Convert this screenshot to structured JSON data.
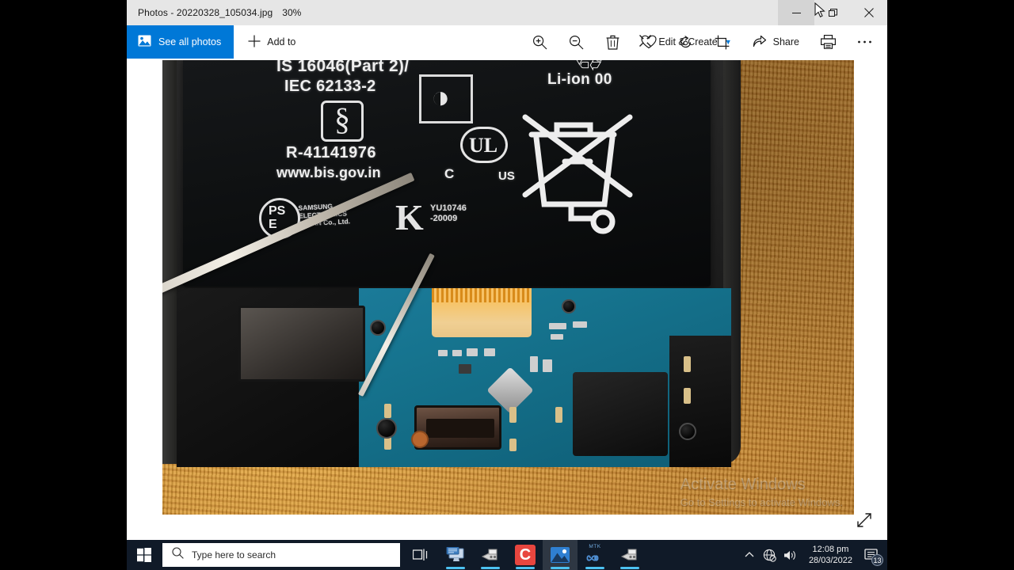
{
  "window": {
    "title": "Photos - 20220328_105034.jpg",
    "zoom_level": "30%",
    "controls": {
      "minimize": "minimize-button",
      "restore": "restore-button",
      "close": "close-button"
    }
  },
  "toolbar": {
    "see_all_photos": "See all photos",
    "add_to": "Add to",
    "zoom_in": "Zoom in",
    "zoom_out": "Zoom out",
    "delete": "Delete",
    "favorite": "Add to favorites",
    "rotate": "Rotate",
    "crop": "Crop & rotate",
    "edit_create": "Edit & Create",
    "share": "Share",
    "print": "Print",
    "more": "See more"
  },
  "photo": {
    "battery_label": {
      "standard_line1": "IS 16046(Part 2)/",
      "standard_line2": "IEC 62133-2",
      "registration": "R-41141976",
      "website": "www.bis.gov.in",
      "ce_mark": "C",
      "us_mark": "US",
      "chemistry": "Li-ion 00",
      "manufacturer": "SAMSUNG\nELECTRONICS\nJAPAN Co., Ltd.",
      "kc_code": "YU10746\n-20009",
      "pse_mark": "PSE"
    }
  },
  "watermark": {
    "line1": "Activate Windows",
    "line2": "Go to Settings to activate Windows."
  },
  "taskbar": {
    "start": "Start",
    "search_placeholder": "Type here to search",
    "apps": [
      {
        "name": "task-view",
        "label": "Task View"
      },
      {
        "name": "remote-desktop",
        "label": "Remote Desktop"
      },
      {
        "name": "tool-app-1",
        "label": "Tool"
      },
      {
        "name": "camtasia",
        "label": "Camtasia",
        "letter": "C"
      },
      {
        "name": "photos",
        "label": "Photos",
        "active": true
      },
      {
        "name": "mtk-tool",
        "label": "MTK",
        "caption": "MTK"
      },
      {
        "name": "tool-app-2",
        "label": "Tool"
      }
    ],
    "tray": {
      "show_hidden": "Show hidden icons",
      "network": "No internet access",
      "volume": "Volume",
      "time": "12:08 pm",
      "date": "28/03/2022",
      "notifications_count": "13"
    }
  },
  "colors": {
    "accent": "#0078d7",
    "titlebar": "#e6e6e6",
    "taskbar": "#101a28",
    "indicator": "#4cc2f1"
  }
}
